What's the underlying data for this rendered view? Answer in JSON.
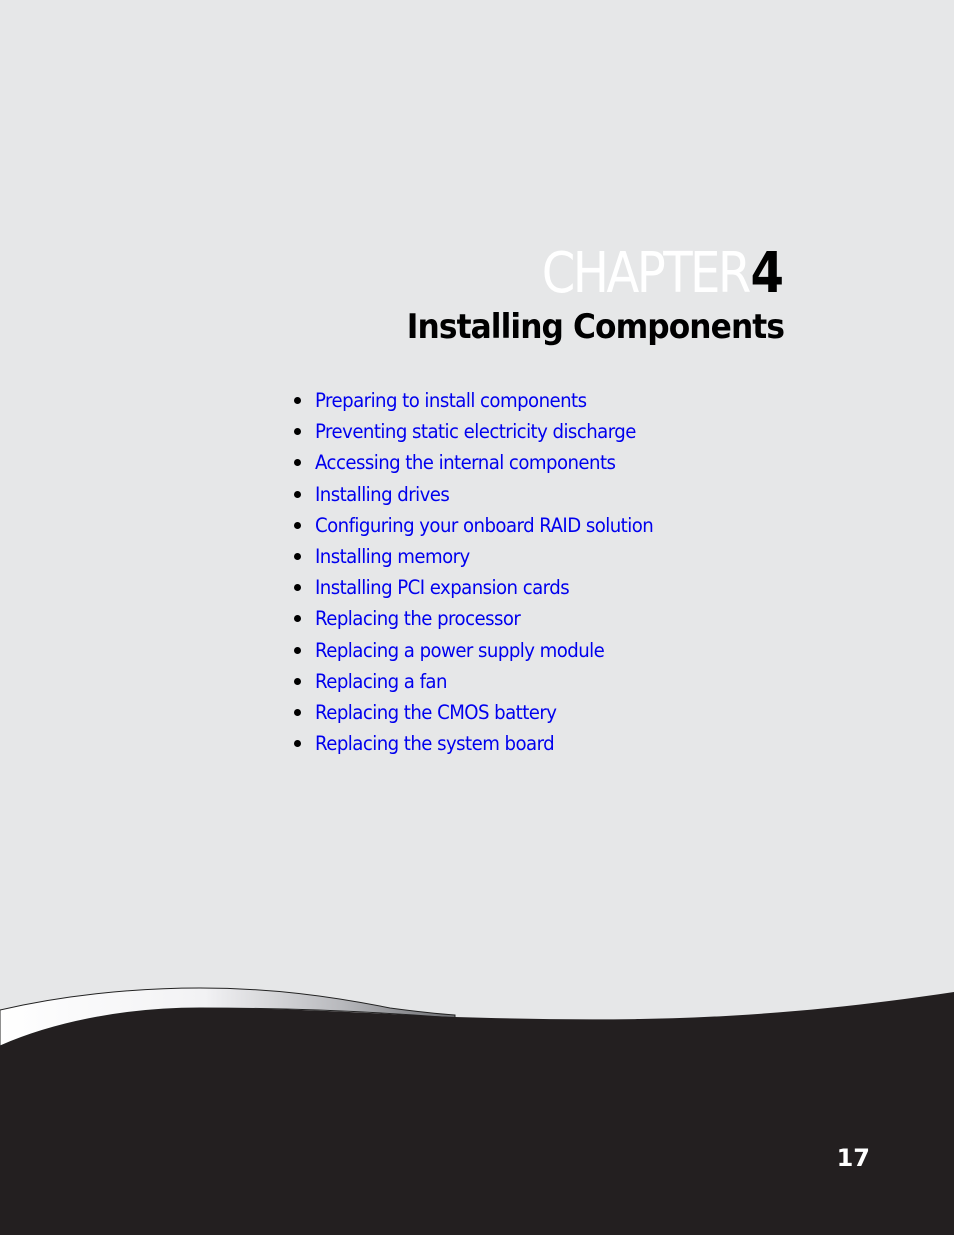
{
  "chapter": {
    "label": "CHAPTER",
    "number": "4",
    "title": "Installing Components"
  },
  "topics": [
    {
      "label": "Preparing to install components"
    },
    {
      "label": "Preventing static electricity discharge"
    },
    {
      "label": "Accessing the internal components"
    },
    {
      "label": "Installing drives"
    },
    {
      "label": "Configuring your onboard RAID solution"
    },
    {
      "label": "Installing memory"
    },
    {
      "label": "Installing PCI expansion cards"
    },
    {
      "label": "Replacing the processor"
    },
    {
      "label": "Replacing a power supply module"
    },
    {
      "label": "Replacing a fan"
    },
    {
      "label": "Replacing the CMOS battery"
    },
    {
      "label": "Replacing the system board"
    }
  ],
  "footer": {
    "page_number": "17"
  },
  "colors": {
    "background": "#e6e7e8",
    "link": "#0000ee",
    "footer": "#231f20",
    "chapter_word": "#ffffff"
  }
}
